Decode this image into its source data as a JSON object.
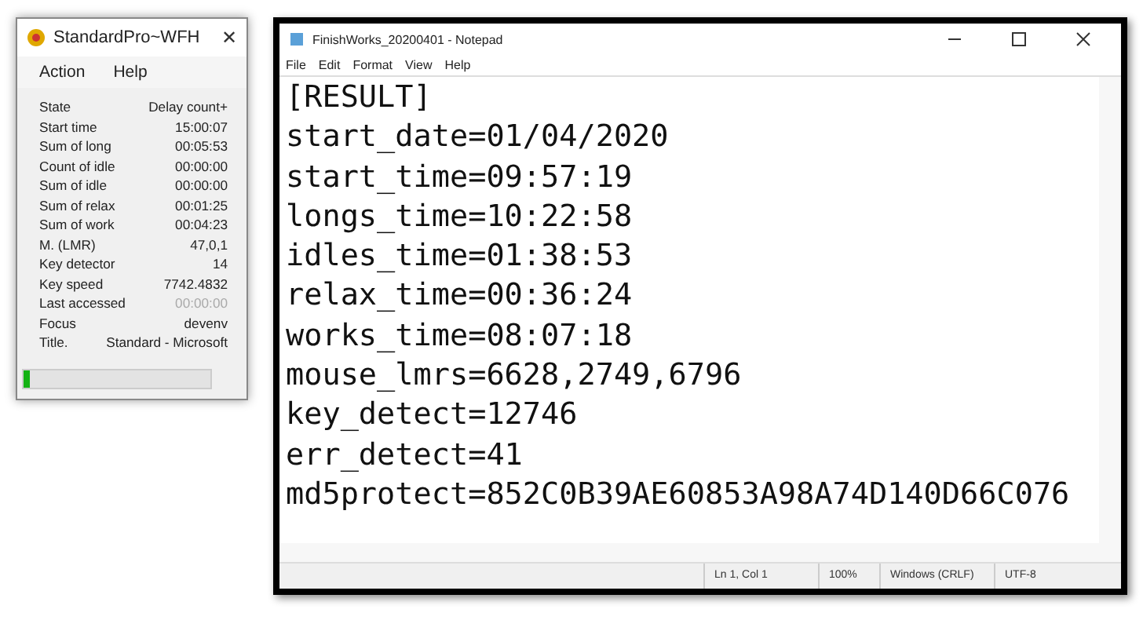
{
  "small_window": {
    "title": "StandardPro~WFH",
    "close": "✕",
    "menu": [
      "Action",
      "Help"
    ],
    "rows": [
      {
        "label": "State",
        "value": "Delay count+",
        "disabled": false
      },
      {
        "label": "Start time",
        "value": "15:00:07",
        "disabled": false
      },
      {
        "label": "Sum of long",
        "value": "00:05:53",
        "disabled": false
      },
      {
        "label": "Count of idle",
        "value": "00:00:00",
        "disabled": false
      },
      {
        "label": "Sum of idle",
        "value": "00:00:00",
        "disabled": false
      },
      {
        "label": "Sum of relax",
        "value": "00:01:25",
        "disabled": false
      },
      {
        "label": "Sum of work",
        "value": "00:04:23",
        "disabled": false
      },
      {
        "label": "M. (LMR)",
        "value": "47,0,1",
        "disabled": false
      },
      {
        "label": "Key detector",
        "value": "14",
        "disabled": false
      },
      {
        "label": "Key speed",
        "value": "7742.4832",
        "disabled": false
      },
      {
        "label": "Last accessed",
        "value": "00:00:00",
        "disabled": true
      },
      {
        "label": "Focus",
        "value": "devenv",
        "disabled": false
      },
      {
        "label": "Title.",
        "value": "Standard - Microsoft",
        "disabled": false
      }
    ],
    "progress": {
      "level": 0.03
    }
  },
  "notepad": {
    "title": "FinishWorks_20200401 - Notepad",
    "menu": [
      "File",
      "Edit",
      "Format",
      "View",
      "Help"
    ],
    "lines": [
      "[RESULT]",
      "start_date=01/04/2020",
      "start_time=09:57:19",
      "longs_time=10:22:58",
      "idles_time=01:38:53",
      "relax_time=00:36:24",
      "works_time=08:07:18",
      "mouse_lmrs=6628,2749,6796",
      "key_detect=12746",
      "err_detect=41",
      "md5protect=852C0B39AE60853A98A74D140D66C076"
    ],
    "status_bar": [
      "Ln 1, Col 1",
      "100%",
      "Windows (CRLF)",
      "UTF-8"
    ]
  }
}
